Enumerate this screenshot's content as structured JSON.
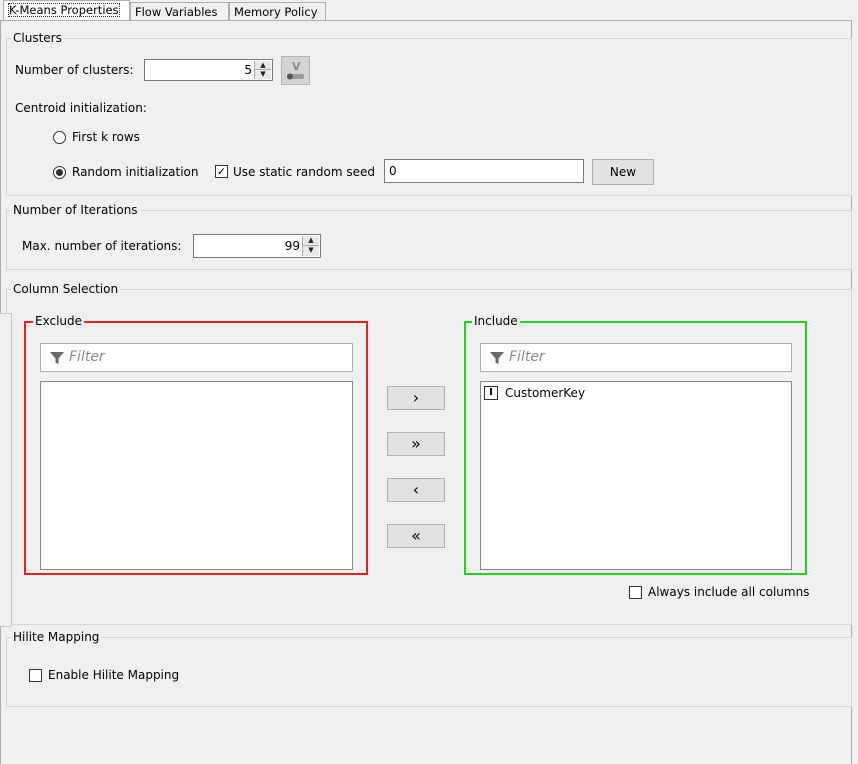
{
  "tabs": [
    {
      "label": "K-Means Properties",
      "active": true
    },
    {
      "label": "Flow Variables",
      "active": false
    },
    {
      "label": "Memory Policy",
      "active": false
    }
  ],
  "clusters": {
    "legend": "Clusters",
    "num_clusters_label": "Number of clusters:",
    "num_clusters_value": "5",
    "centroid_label": "Centroid initialization:",
    "first_k_label": "First k rows",
    "first_k_selected": false,
    "random_label": "Random initialization",
    "random_selected": true,
    "static_seed_label": "Use static random seed",
    "static_seed_checked": true,
    "seed_value": "0",
    "new_button": "New"
  },
  "iterations": {
    "legend": "Number of Iterations",
    "max_label": "Max. number of iterations:",
    "max_value": "99"
  },
  "columns": {
    "legend": "Column Selection",
    "exclude_title": "Exclude",
    "include_title": "Include",
    "exclude_filter_placeholder": "Filter",
    "include_filter_placeholder": "Filter",
    "exclude_items": [],
    "include_items": [
      {
        "type_badge": "I",
        "name": "CustomerKey"
      }
    ],
    "move_right": "›",
    "move_all_right": "»",
    "move_left": "‹",
    "move_all_left": "«",
    "always_include_label": "Always include all columns",
    "always_include_checked": false,
    "exclude_color": "#e8231f",
    "include_color": "#1fd61f"
  },
  "hilite": {
    "legend": "Hilite Mapping",
    "enable_label": "Enable Hilite Mapping",
    "enable_checked": false
  }
}
